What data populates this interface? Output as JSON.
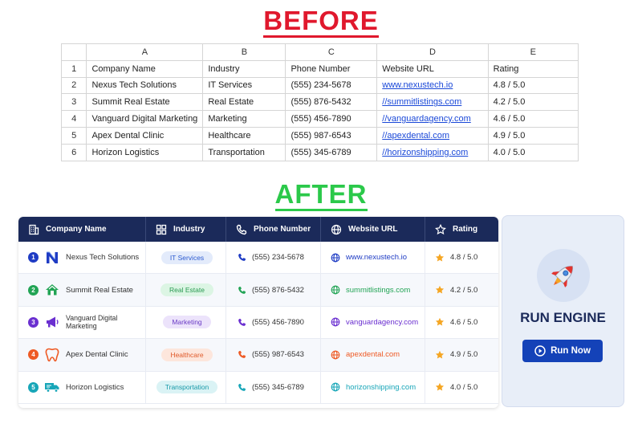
{
  "headings": {
    "before": "BEFORE",
    "after": "AFTER"
  },
  "sheet": {
    "columns": [
      "",
      "A",
      "B",
      "C",
      "D",
      "E"
    ],
    "rows": [
      {
        "n": "1",
        "company": "Company Name",
        "industry": "Industry",
        "phone": "Phone Number",
        "url": "Website URL",
        "rating": "Rating"
      },
      {
        "n": "2",
        "company": "Nexus Tech Solutions",
        "industry": "IT Services",
        "phone": "(555) 234-5678",
        "url": "www.nexustech.io",
        "rating": "4.8 / 5.0"
      },
      {
        "n": "3",
        "company": "Summit Real Estate",
        "industry": "Real Estate",
        "phone": "(555) 876-5432",
        "url": "//summitlistings.com",
        "rating": "4.2 / 5.0"
      },
      {
        "n": "4",
        "company": "Vanguard Digital Marketing",
        "industry": "Marketing",
        "phone": "(555) 456-7890",
        "url": "//vanguardagency.com",
        "rating": "4.6 / 5.0"
      },
      {
        "n": "5",
        "company": "Apex Dental Clinic",
        "industry": "Healthcare",
        "phone": "(555) 987-6543",
        "url": "//apexdental.com",
        "rating": "4.9 / 5.0"
      },
      {
        "n": "6",
        "company": "Horizon Logistics",
        "industry": "Transportation",
        "phone": "(555) 345-6789",
        "url": "//horizonshipping.com",
        "rating": "4.0 / 5.0"
      }
    ]
  },
  "table": {
    "headers": {
      "company": "Company Name",
      "industry": "Industry",
      "phone": "Phone Number",
      "url": "Website URL",
      "rating": "Rating"
    },
    "rows": [
      {
        "num": "1",
        "company": "Nexus Tech Solutions",
        "industry": "IT Services",
        "phone": "(555) 234-5678",
        "url": "www.nexustech.io",
        "rating": "4.8 / 5.0",
        "color": "#1f3cc4",
        "pill_bg": "#e3ebfb",
        "pill_fg": "#2d5bd0",
        "logo_icon": "n-logo-icon"
      },
      {
        "num": "2",
        "company": "Summit Real Estate",
        "industry": "Real Estate",
        "phone": "(555) 876-5432",
        "url": "summitlistings.com",
        "rating": "4.2 / 5.0",
        "color": "#22a455",
        "pill_bg": "#dcf5e4",
        "pill_fg": "#2a9a52",
        "logo_icon": "house-icon"
      },
      {
        "num": "3",
        "company": "Vanguard Digital Marketing",
        "industry": "Marketing",
        "phone": "(555) 456-7890",
        "url": "vanguardagency.com",
        "rating": "4.6 / 5.0",
        "color": "#6a2fd0",
        "pill_bg": "#ece3fb",
        "pill_fg": "#6a3bc5",
        "logo_icon": "megaphone-icon"
      },
      {
        "num": "4",
        "company": "Apex Dental Clinic",
        "industry": "Healthcare",
        "phone": "(555) 987-6543",
        "url": "apexdental.com",
        "rating": "4.9 / 5.0",
        "color": "#ee5a24",
        "pill_bg": "#fde6dc",
        "pill_fg": "#e05a2a",
        "logo_icon": "tooth-icon"
      },
      {
        "num": "5",
        "company": "Horizon Logistics",
        "industry": "Transportation",
        "phone": "(555) 345-6789",
        "url": "horizonshipping.com",
        "rating": "4.0 / 5.0",
        "color": "#18a6b8",
        "pill_bg": "#daf3f5",
        "pill_fg": "#1799a8",
        "logo_icon": "truck-icon"
      }
    ]
  },
  "panel": {
    "title": "RUN ENGINE",
    "button_label": "Run Now",
    "icon": "rocket-icon"
  },
  "colors": {
    "header_bg": "#1b2a5a",
    "button_bg": "#1442b8",
    "star": "#f5a623",
    "before": "#e0182d",
    "after": "#2bc94a"
  }
}
